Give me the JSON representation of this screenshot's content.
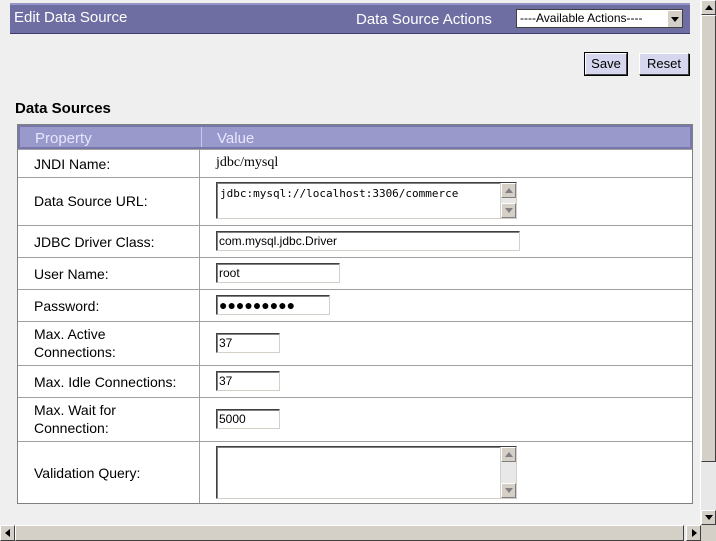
{
  "header": {
    "title": "Edit Data Source",
    "actions_label": "Data Source Actions",
    "actions_select": {
      "selected": "----Available Actions----"
    }
  },
  "toolbar": {
    "save_label": "Save",
    "reset_label": "Reset"
  },
  "section": {
    "title": "Data Sources"
  },
  "table": {
    "columns": {
      "property": "Property",
      "value": "Value"
    },
    "rows": {
      "jndi_name": {
        "label": "JNDI Name:",
        "value": "jdbc/mysql"
      },
      "data_source_url": {
        "label": "Data Source URL:",
        "value": "jdbc:mysql://localhost:3306/commerce"
      },
      "jdbc_driver_class": {
        "label": "JDBC Driver Class:",
        "value": "com.mysql.jdbc.Driver"
      },
      "user_name": {
        "label": "User Name:",
        "value": "root"
      },
      "password": {
        "label": "Password:",
        "masked_value": "●●●●●●●●●"
      },
      "max_active": {
        "label_line1": "Max. Active",
        "label_line2": "Connections:",
        "value": "37"
      },
      "max_idle": {
        "label": "Max. Idle Connections:",
        "value": "37"
      },
      "max_wait": {
        "label_line1": "Max. Wait for",
        "label_line2": "Connection:",
        "value": "5000"
      },
      "validation_query": {
        "label": "Validation Query:",
        "value": ""
      }
    }
  },
  "colors": {
    "title_bar": "#6e6ea3",
    "table_header": "#9999cc",
    "button_face": "#d6d6ee",
    "page_background": "#efefef"
  },
  "icons": {
    "select_arrow": "chevron-down-icon",
    "scroll_up": "arrow-up-icon",
    "scroll_down": "arrow-down-icon",
    "scroll_left": "arrow-left-icon",
    "scroll_right": "arrow-right-icon"
  }
}
